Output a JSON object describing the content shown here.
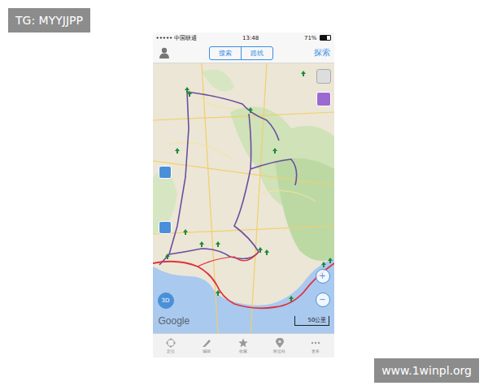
{
  "watermarks": {
    "top_left": "TG: MYYJJPP",
    "bottom_right": "www.1winpl.org"
  },
  "status_bar": {
    "carrier": "••••• 中国联通",
    "time": "13:48",
    "battery": "71%",
    "battery_level": 0.71
  },
  "nav_bar": {
    "segments": [
      {
        "label": "搜索",
        "selected": false
      },
      {
        "label": "路线",
        "selected": false
      }
    ],
    "explore": "探索"
  },
  "map": {
    "logo": "Google",
    "scale": "50公里",
    "mode_button": "3D",
    "zoom_in": "+",
    "zoom_out": "−"
  },
  "tab_bar": [
    {
      "label": "定位",
      "selected": false
    },
    {
      "label": "编辑",
      "selected": false
    },
    {
      "label": "收藏",
      "selected": false
    },
    {
      "label": "附近站",
      "selected": false
    },
    {
      "label": "更多",
      "selected": false
    }
  ]
}
